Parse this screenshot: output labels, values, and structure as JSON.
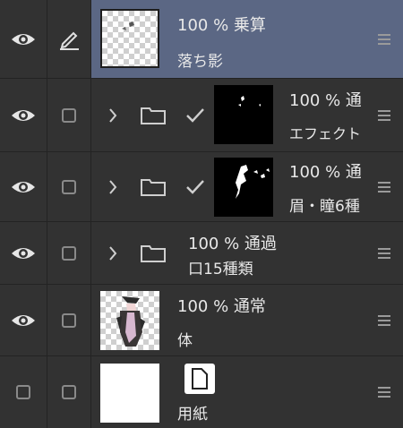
{
  "layers": [
    {
      "opacity": "100 %",
      "blend": "乗算",
      "name": "落ち影",
      "top_label": "100 % 乗算",
      "visible": true,
      "selected": true,
      "type": "raster"
    },
    {
      "top_label": "100 % 通",
      "name": "エフェクト",
      "visible": true,
      "type": "folder-with-mask"
    },
    {
      "top_label": "100 % 通",
      "name": "眉・瞳6種",
      "visible": true,
      "type": "folder-with-mask"
    },
    {
      "top_label": "100 % 通過",
      "name": "口15種類",
      "visible": true,
      "type": "folder"
    },
    {
      "top_label": "100 % 通常",
      "name": "体",
      "visible": true,
      "type": "raster"
    },
    {
      "top_label": "",
      "name": "用紙",
      "visible": false,
      "type": "paper"
    }
  ],
  "colors": {
    "panel_bg": "#323232",
    "selected_bg": "#5b6784",
    "divider": "#232323",
    "text": "#e8e8e8"
  }
}
